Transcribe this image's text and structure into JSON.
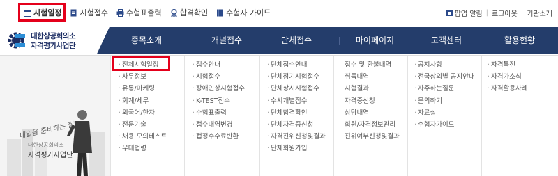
{
  "top_links": [
    {
      "label": "시험일정",
      "icon": "calendar-icon"
    },
    {
      "label": "시험접수",
      "icon": "document-icon"
    },
    {
      "label": "수험표출력",
      "icon": "print-icon"
    },
    {
      "label": "합격확인",
      "icon": "award-icon"
    },
    {
      "label": "수험자 가이드",
      "icon": "book-icon"
    }
  ],
  "right_links": [
    "팝업 알림",
    "로그아웃",
    "기관소개"
  ],
  "logo": {
    "line1": "대한상공회의소",
    "line2": "자격평가사업단"
  },
  "nav": [
    "종목소개",
    "개별접수",
    "단체접수",
    "마이페이지",
    "고객센터",
    "활용현황"
  ],
  "menu_columns": [
    [
      "전체시험일정",
      "사무정보",
      "유통/마케팅",
      "회계/세무",
      "외국어/한자",
      "전문기술",
      "채용 모의테스트",
      "우대법령"
    ],
    [
      "접수안내",
      "시험접수",
      "장애인상시험접수",
      "K-TEST접수",
      "수험표출력",
      "접수내역변경",
      "접정수수료반환"
    ],
    [
      "단체접수안내",
      "단체정기시험접수",
      "단체상시시험접수",
      "수시개별접수",
      "단체합격확인",
      "단체자격증신청",
      "자격진위신청및결과",
      "단체회원가입"
    ],
    [
      "접수 및 환불내역",
      "취득내역",
      "시험결과",
      "자격증신청",
      "상담내역",
      "회원/자격정보관리",
      "진위여부신청및결과"
    ],
    [
      "공지사항",
      "전국상의별 공지안내",
      "자주하는질문",
      "문의하기",
      "자료실",
      "수험자가이드"
    ],
    [
      "자격특전",
      "자격가소식",
      "자격활용사례"
    ]
  ],
  "promo": {
    "script": "내일을 준비하는 힘!",
    "org1": "대한상공회의소",
    "org2": "자격평가사업단"
  },
  "colors": {
    "nav_bg": "#243d6b",
    "highlight": "#e4001b"
  }
}
